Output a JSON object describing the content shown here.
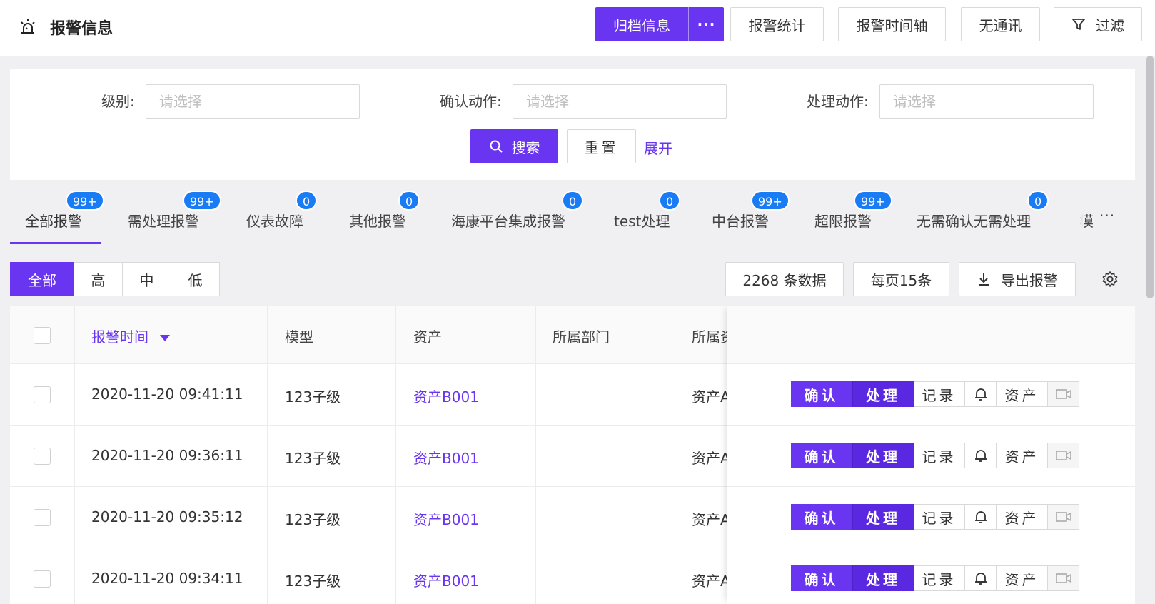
{
  "header": {
    "title": "报警信息",
    "archive_label": "归档信息",
    "archive_more": "···",
    "stats_label": "报警统计",
    "timeline_label": "报警时间轴",
    "nocomm_label": "无通讯",
    "filter_label": "过滤"
  },
  "filters": {
    "level_label": "级别:",
    "confirm_label": "确认动作:",
    "handle_label": "处理动作:",
    "placeholder": "请选择",
    "search_label": "搜索",
    "reset_label": "重置",
    "expand_label": "展开"
  },
  "tabs": [
    {
      "label": "全部报警",
      "badge": "99+"
    },
    {
      "label": "需处理报警",
      "badge": "99+"
    },
    {
      "label": "仪表故障",
      "badge": "0"
    },
    {
      "label": "其他报警",
      "badge": "0"
    },
    {
      "label": "海康平台集成报警",
      "badge": "0"
    },
    {
      "label": "test处理",
      "badge": "0"
    },
    {
      "label": "中台报警",
      "badge": "99+"
    },
    {
      "label": "超限报警",
      "badge": "99+"
    },
    {
      "label": "无需确认无需处理",
      "badge": "0"
    },
    {
      "label": "模",
      "badge": ""
    }
  ],
  "tabs_more": "···",
  "levels": [
    "全部",
    "高",
    "中",
    "低"
  ],
  "toolbar": {
    "count_label": "2268 条数据",
    "page_size_label": "每页15条",
    "export_label": "导出报警"
  },
  "table": {
    "columns": [
      "报警时间",
      "模型",
      "资产",
      "所属部门",
      "所属资"
    ],
    "rows": [
      {
        "time": "2020-11-20 09:41:11",
        "model": "123子级",
        "asset": "资产B001",
        "dept": "",
        "asset2": "资产A"
      },
      {
        "time": "2020-11-20 09:36:11",
        "model": "123子级",
        "asset": "资产B001",
        "dept": "",
        "asset2": "资产A"
      },
      {
        "time": "2020-11-20 09:35:12",
        "model": "123子级",
        "asset": "资产B001",
        "dept": "",
        "asset2": "资产A"
      },
      {
        "time": "2020-11-20 09:34:11",
        "model": "123子级",
        "asset": "资产B001",
        "dept": "",
        "asset2": "资产A"
      }
    ],
    "actions": {
      "confirm": "确认",
      "handle": "处理",
      "record": "记录",
      "asset": "资产"
    }
  },
  "colors": {
    "primary": "#6a35f0",
    "badge": "#1a7cf5"
  }
}
